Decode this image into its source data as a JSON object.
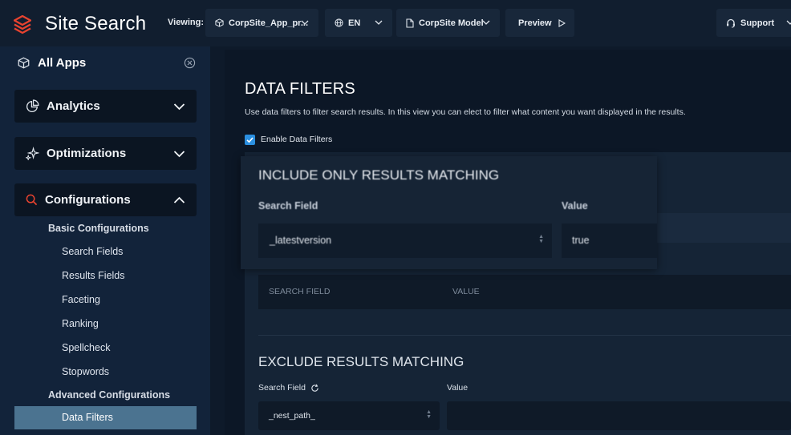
{
  "app": {
    "title": "Site Search"
  },
  "toolbar": {
    "viewing_label": "Viewing:",
    "app_selector": "CorpSite_App_pr...",
    "language": "EN",
    "model": "CorpSite Model",
    "preview": "Preview",
    "support": "Support"
  },
  "sidebar": {
    "all_apps": "All Apps",
    "analytics": "Analytics",
    "optimizations": "Optimizations",
    "configurations": "Configurations",
    "basic_head": "Basic Configurations",
    "basic_items": [
      "Search Fields",
      "Results Fields",
      "Faceting",
      "Ranking",
      "Spellcheck",
      "Stopwords"
    ],
    "advanced_head": "Advanced Configurations",
    "active_item": "Data Filters"
  },
  "main": {
    "title": "DATA FILTERS",
    "description": "Use data filters to filter search results. In this view you can elect to filter what content you want displayed in the results.",
    "enable_label": "Enable Data Filters",
    "enable_checked": true,
    "include_table_headers": [
      "SEARCH FIELD",
      "VALUE"
    ],
    "exclude": {
      "title": "EXCLUDE RESULTS MATCHING",
      "search_field_label": "Search Field",
      "value_label": "Value",
      "search_field_value": "_nest_path_",
      "value": ""
    }
  },
  "include_popup": {
    "title": "INCLUDE ONLY RESULTS MATCHING",
    "search_field_label": "Search Field",
    "value_label": "Value",
    "search_field_value": "_latestversion",
    "value": "true"
  },
  "colors": {
    "accent_orange": "#e8432f",
    "checkbox_blue": "#2b8fe0",
    "active_item_bg": "#4b7390"
  }
}
